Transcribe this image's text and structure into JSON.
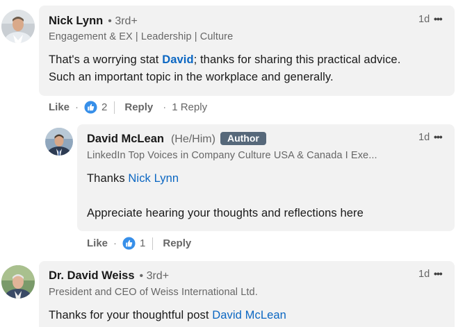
{
  "comments": [
    {
      "name": "Nick Lynn",
      "degree": "3rd+",
      "headline": "Engagement & EX | Leadership | Culture",
      "time": "1d",
      "body": {
        "line1_before": "That's a worrying stat ",
        "mention": "David",
        "line1_after": "; thanks for sharing this practical advice.",
        "line2": "Such an important topic in the workplace and generally."
      },
      "actions": {
        "like_label": "Like",
        "reaction_count": "2",
        "reply_label": "Reply",
        "reply_count": "1 Reply"
      }
    },
    {
      "name": "David McLean",
      "pronoun": "(He/Him)",
      "badge": "Author",
      "headline": "LinkedIn Top Voices in Company Culture USA & Canada I Exe...",
      "time": "1d",
      "body": {
        "line1_before": "Thanks ",
        "mention": "Nick Lynn",
        "line2": "Appreciate hearing your thoughts and reflections here"
      },
      "actions": {
        "like_label": "Like",
        "reaction_count": "1",
        "reply_label": "Reply"
      }
    },
    {
      "name": "Dr. David Weiss",
      "degree": "3rd+",
      "headline": "President and CEO of Weiss International Ltd.",
      "time": "1d",
      "body": {
        "line1_before": "Thanks for your thoughtful post ",
        "mention": "David McLean"
      }
    }
  ],
  "separator_dot": "·",
  "degree_dot": "•",
  "more_glyph": "•••",
  "icons": {
    "like": "thumbs-up-icon",
    "more": "ellipsis-icon"
  },
  "colors": {
    "bubble_bg": "#f2f2f2",
    "link": "#0a66c2",
    "badge_bg": "#56687a",
    "like_blue": "#378fe9"
  }
}
